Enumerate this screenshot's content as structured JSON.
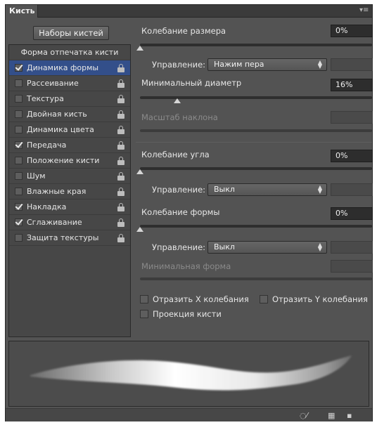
{
  "panel": {
    "tab_title": "Кисть",
    "presets_button": "Наборы кистей"
  },
  "left_list": {
    "header": "Форма отпечатка кисти",
    "items": [
      {
        "label": "Динамика формы",
        "checked": true,
        "selected": true
      },
      {
        "label": "Рассеивание",
        "checked": false,
        "selected": false
      },
      {
        "label": "Текстура",
        "checked": false,
        "selected": false
      },
      {
        "label": "Двойная кисть",
        "checked": false,
        "selected": false
      },
      {
        "label": "Динамика цвета",
        "checked": false,
        "selected": false
      },
      {
        "label": "Передача",
        "checked": true,
        "selected": false
      },
      {
        "label": "Положение кисти",
        "checked": false,
        "selected": false
      },
      {
        "label": "Шум",
        "checked": false,
        "selected": false
      },
      {
        "label": "Влажные края",
        "checked": false,
        "selected": false
      },
      {
        "label": "Накладка",
        "checked": true,
        "selected": false
      },
      {
        "label": "Сглаживание",
        "checked": true,
        "selected": false
      },
      {
        "label": "Защита текстуры",
        "checked": false,
        "selected": false
      }
    ]
  },
  "size_jitter": {
    "label": "Колебание размера",
    "value": "0%",
    "slider": 0,
    "control_label": "Управление:",
    "control_value": "Нажим пера"
  },
  "min_diameter": {
    "label": "Минимальный диаметр",
    "value": "16%",
    "slider": 0.16
  },
  "tilt_scale": {
    "label": "Масштаб наклона"
  },
  "angle_jitter": {
    "label": "Колебание угла",
    "value": "0%",
    "slider": 0,
    "control_label": "Управление:",
    "control_value": "Выкл"
  },
  "roundness_jitter": {
    "label": "Колебание формы",
    "value": "0%",
    "slider": 0,
    "control_label": "Управление:",
    "control_value": "Выкл"
  },
  "min_roundness": {
    "label": "Минимальная форма"
  },
  "options": {
    "flip_x": "Отразить X колебания",
    "flip_y": "Отразить Y колебания",
    "brush_projection": "Проекция кисти"
  },
  "colors": {
    "panel_bg": "#535353",
    "selected_row": "#334f8a",
    "field_bg": "#2d2d2d"
  },
  "icons": [
    "panel-menu-icon",
    "lock-icon",
    "checkmark-icon",
    "dropdown-arrow-icon",
    "brush-toggle-icon",
    "grid-icon",
    "new-preset-icon"
  ]
}
